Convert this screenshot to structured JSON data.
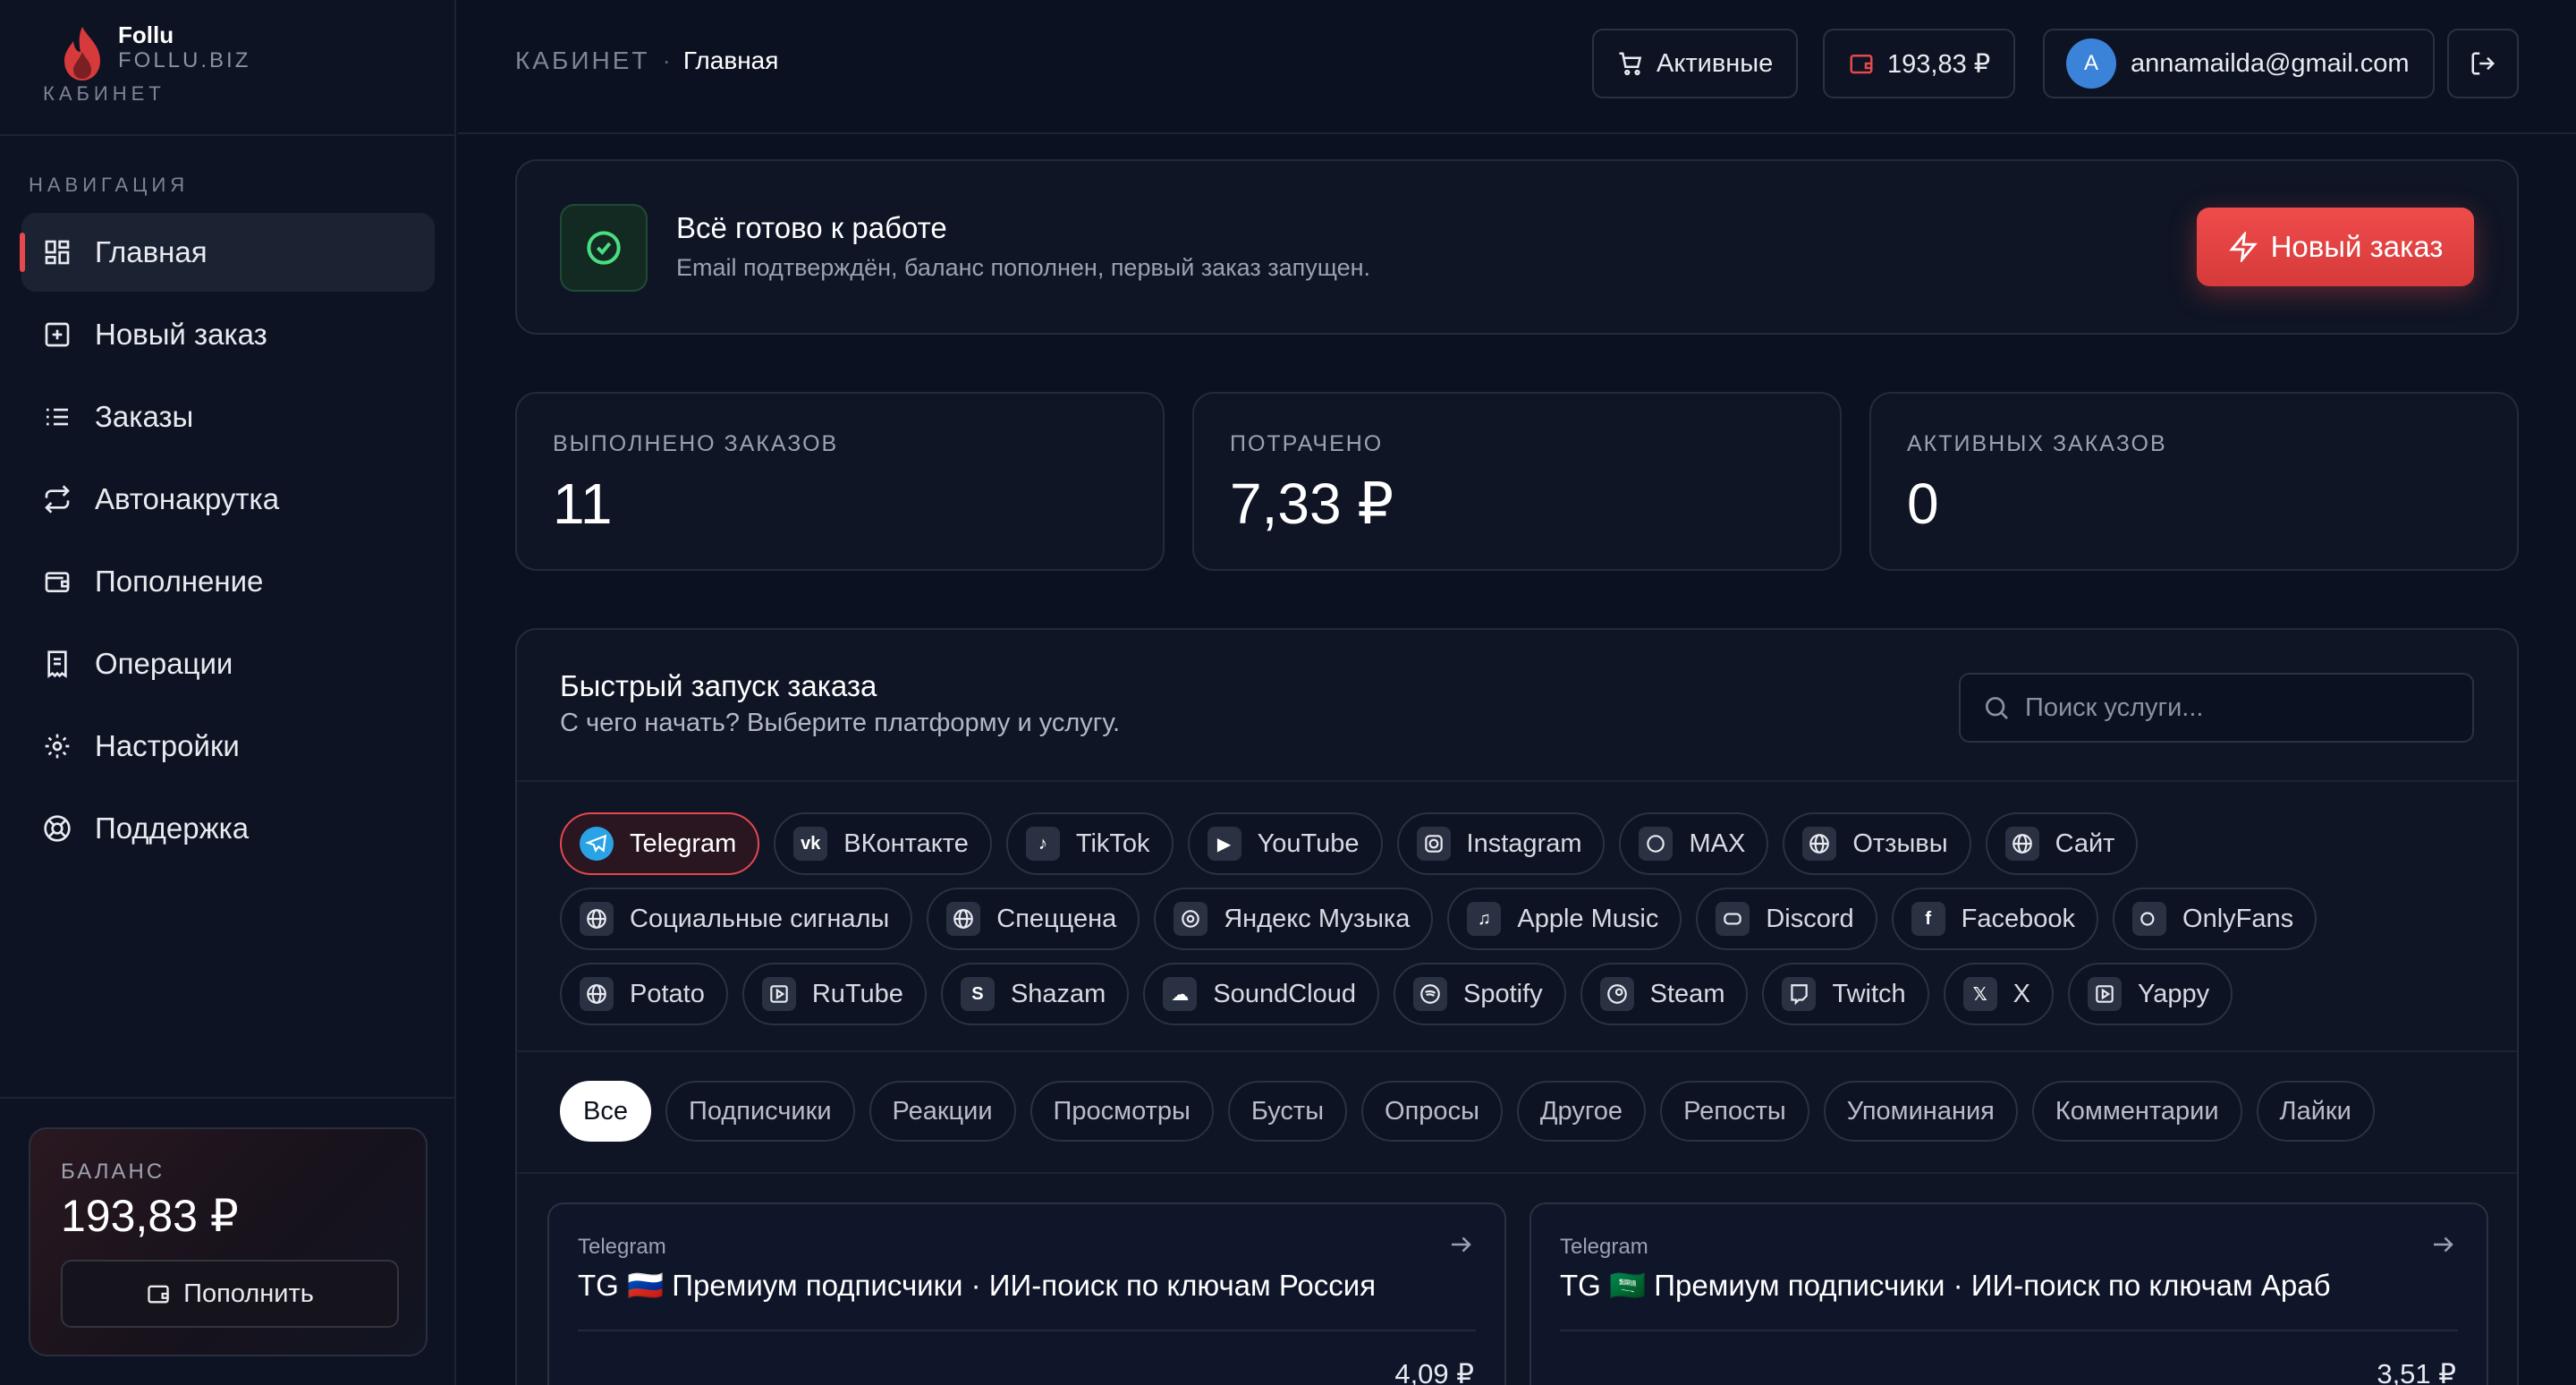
{
  "brand": {
    "name": "Follu",
    "domain": "FOLLU.BIZ",
    "section": "КАБИНЕТ"
  },
  "sidebar": {
    "nav_title": "НАВИГАЦИЯ",
    "items": [
      {
        "label": "Главная",
        "icon": "grid-icon",
        "active": true
      },
      {
        "label": "Новый заказ",
        "icon": "plus-square-icon"
      },
      {
        "label": "Заказы",
        "icon": "list-icon"
      },
      {
        "label": "Автонакрутка",
        "icon": "repeat-icon"
      },
      {
        "label": "Пополнение",
        "icon": "wallet-icon"
      },
      {
        "label": "Операции",
        "icon": "receipt-icon"
      },
      {
        "label": "Настройки",
        "icon": "gear-icon"
      },
      {
        "label": "Поддержка",
        "icon": "lifebuoy-icon"
      }
    ],
    "balance": {
      "label": "БАЛАНС",
      "value": "193,83 ₽",
      "topup_label": "Пополнить"
    }
  },
  "header": {
    "breadcrumb_root": "КАБИНЕТ",
    "breadcrumb_sep": "·",
    "breadcrumb_current": "Главная",
    "active_label": "Активные",
    "balance": "193,83 ₽",
    "user_initial": "A",
    "user_email": "annamailda@gmail.com"
  },
  "ready": {
    "title": "Всё готово к работе",
    "description": "Email подтверждён, баланс пополнен, первый заказ запущен.",
    "new_order_label": "Новый заказ"
  },
  "stats": [
    {
      "label": "ВЫПОЛНЕНО ЗАКАЗОВ",
      "value": "11"
    },
    {
      "label": "ПОТРАЧЕНО",
      "value": "7,33 ₽"
    },
    {
      "label": "АКТИВНЫХ ЗАКАЗОВ",
      "value": "0"
    }
  ],
  "quick": {
    "title": "Быстрый запуск заказа",
    "subtitle": "С чего начать? Выберите платформу и услугу.",
    "search_placeholder": "Поиск услуги...",
    "platforms": [
      [
        "Telegram",
        "ВКонтакте",
        "TikTok",
        "YouTube",
        "Instagram",
        "MAX",
        "Отзывы",
        "Сайт"
      ],
      [
        "Социальные сигналы",
        "Спеццена",
        "Яндекс Музыка",
        "Apple Music",
        "Discord",
        "Facebook",
        "OnlyFans"
      ],
      [
        "Potato",
        "RuTube",
        "Shazam",
        "SoundCloud",
        "Spotify",
        "Steam",
        "Twitch",
        "X",
        "Yappy"
      ]
    ],
    "active_platform": "Telegram",
    "categories": [
      "Все",
      "Подписчики",
      "Реакции",
      "Просмотры",
      "Бусты",
      "Опросы",
      "Другое",
      "Репосты",
      "Упоминания",
      "Комментарии",
      "Лайки"
    ],
    "active_category": "Все",
    "services": [
      {
        "platform": "Telegram",
        "title": "TG 🇷🇺 Премиум подписчики · ИИ-поиск по ключам Россия",
        "price": "4,09 ₽"
      },
      {
        "platform": "Telegram",
        "title": "TG 🇸🇦 Премиум подписчики · ИИ-поиск по ключам Араб",
        "price": "3,51 ₽"
      }
    ]
  },
  "colors": {
    "accent": "#e5484d",
    "success": "#4ade80",
    "background": "#0b1120",
    "avatar": "#3b82d9"
  }
}
